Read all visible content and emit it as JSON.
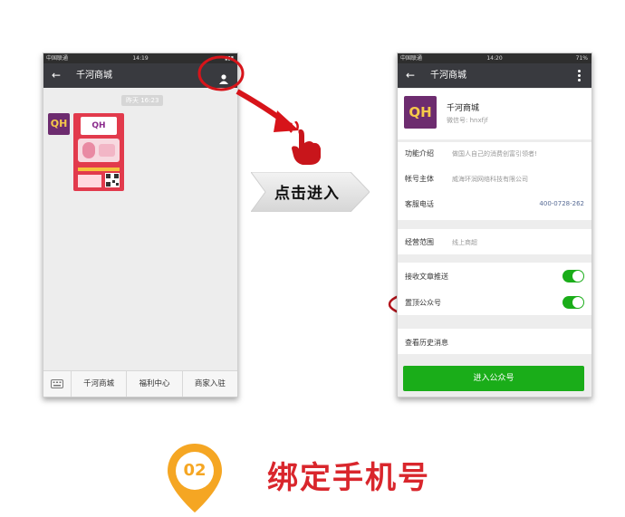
{
  "left_phone": {
    "status": {
      "carrier": "中国联通",
      "time": "14:19"
    },
    "title": "千河商城",
    "time_chip": "昨天 16:23",
    "avatar_text": "QH",
    "bottom_menu": [
      "千河商城",
      "福利中心",
      "商家入驻"
    ]
  },
  "right_phone": {
    "status": {
      "carrier": "中国联通",
      "time": "14:20",
      "battery": "71%"
    },
    "title": "千河商城",
    "account_name": "千河商城",
    "account_id": "微信号: hnxfjf",
    "avatar_text": "QH",
    "info_rows": [
      {
        "label": "功能介绍",
        "value": "做国人自己的消费创富引领者!"
      },
      {
        "label": "帐号主体",
        "value": "威海环润网络科技有限公司"
      },
      {
        "label": "客服电话",
        "value": "400-0728-262"
      }
    ],
    "scope_label": "经营范围",
    "scope_value": "线上商超",
    "push_label": "接收文章推送",
    "top_label": "置顶公众号",
    "history_label": "查看历史消息",
    "enter_button": "进入公众号"
  },
  "arrow_label": "点击进入",
  "step": {
    "number": "02",
    "title": "绑定手机号"
  },
  "colors": {
    "accent_red": "#d7141a",
    "wechat_green": "#1aad19",
    "step_orange": "#f5a623",
    "title_red": "#d9262c"
  }
}
